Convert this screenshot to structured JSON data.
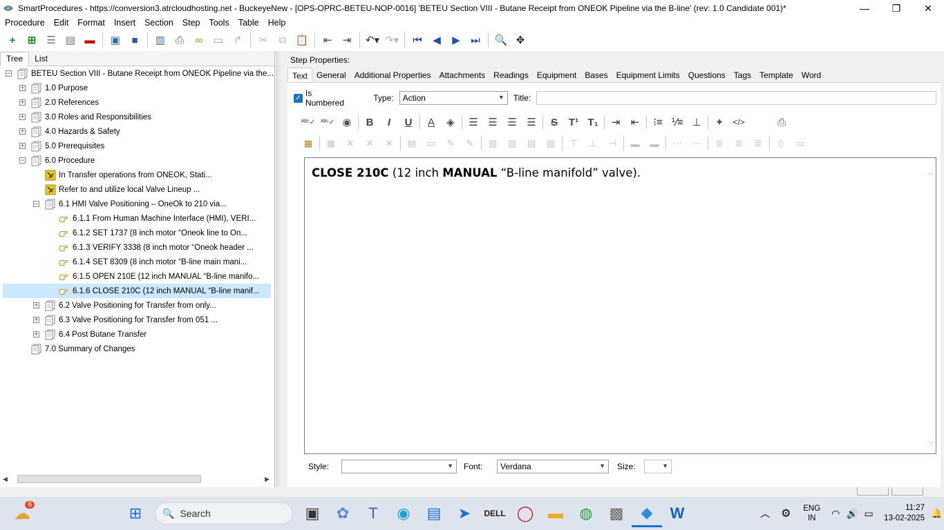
{
  "window": {
    "title": "SmartProcedures - https://conversion3.atrcloudhosting.net - BuckeyeNew - [OPS-OPRC-BETEU-NOP-0016] 'BETEU Section VIII - Butane Receipt from ONEOK Pipeline via the B-line' (rev: 1.0 Candidate 001)*",
    "minimize_glyph": "—",
    "restore_glyph": "❐",
    "close_glyph": "✕"
  },
  "menu": [
    "Procedure",
    "Edit",
    "Format",
    "Insert",
    "Section",
    "Step",
    "Tools",
    "Table",
    "Help"
  ],
  "left_tabs": [
    "Tree",
    "List"
  ],
  "tree": [
    {
      "label": "BETEU Section VIII - Butane Receipt from ONEOK Pipeline via the...",
      "indent": 0,
      "exp": "−",
      "icon": "section"
    },
    {
      "label": "1.0 Purpose",
      "indent": 1,
      "exp": "+",
      "icon": "section"
    },
    {
      "label": "2.0 References",
      "indent": 1,
      "exp": "+",
      "icon": "section"
    },
    {
      "label": "3.0 Roles and Responsibilities",
      "indent": 1,
      "exp": "+",
      "icon": "section"
    },
    {
      "label": "4.0 Hazards & Safety",
      "indent": 1,
      "exp": "+",
      "icon": "section"
    },
    {
      "label": "5.0 Prerequisites",
      "indent": 1,
      "exp": "+",
      "icon": "section"
    },
    {
      "label": "6.0 Procedure",
      "indent": 1,
      "exp": "−",
      "icon": "section"
    },
    {
      "label": "In Transfer operations from ONEOK, Stati...",
      "indent": 2,
      "exp": "",
      "icon": "note"
    },
    {
      "label": "Refer to and utilize local Valve Lineup ...",
      "indent": 2,
      "exp": "",
      "icon": "note"
    },
    {
      "label": "6.1 HMI Valve Positioning – OneOk to 210 via...",
      "indent": 2,
      "exp": "−",
      "icon": "section"
    },
    {
      "label": "6.1.1 From Human Machine Interface (HMI), VERI...",
      "indent": 3,
      "exp": "",
      "icon": "step"
    },
    {
      "label": "6.1.2 SET 1737 (8 inch motor “Oneok line to On...",
      "indent": 3,
      "exp": "",
      "icon": "step"
    },
    {
      "label": "6.1.3 VERIFY 3338 (8 inch motor “Oneok header ...",
      "indent": 3,
      "exp": "",
      "icon": "step"
    },
    {
      "label": "6.1.4 SET 8309 (8 inch motor “B-line main mani...",
      "indent": 3,
      "exp": "",
      "icon": "step"
    },
    {
      "label": "6.1.5 OPEN 210E (12 inch MANUAL “B-line manifo...",
      "indent": 3,
      "exp": "",
      "icon": "step"
    },
    {
      "label": "6.1.6 CLOSE 210C (12 inch MANUAL “B-line manif...",
      "indent": 3,
      "exp": "",
      "icon": "step",
      "selected": true
    },
    {
      "label": "6.2 Valve Positioning for Transfer from only...",
      "indent": 2,
      "exp": "+",
      "icon": "section"
    },
    {
      "label": "6.3 Valve Positioning for Transfer from 051 ...",
      "indent": 2,
      "exp": "+",
      "icon": "section"
    },
    {
      "label": "6.4 Post Butane Transfer",
      "indent": 2,
      "exp": "+",
      "icon": "section"
    },
    {
      "label": "7.0 Summary of Changes",
      "indent": 1,
      "exp": "",
      "icon": "section"
    }
  ],
  "step_properties": {
    "header": "Step Properties:",
    "tabs": [
      "Text",
      "General",
      "Additional Properties",
      "Attachments",
      "Readings",
      "Equipment",
      "Bases",
      "Equipment Limits",
      "Questions",
      "Tags",
      "Template",
      "Word"
    ],
    "is_numbered_label": "Is Numbered",
    "is_numbered": true,
    "type_label": "Type:",
    "type_value": "Action",
    "title_label": "Title:",
    "title_value": "",
    "editor": {
      "part1": "CLOSE 210C",
      "part2": " (12 inch ",
      "part3": "MANUAL",
      "part4": " “B-line manifold” valve)."
    },
    "style_label": "Style:",
    "style_value": "",
    "font_label": "Font:",
    "font_value": "Verdana",
    "size_label": "Size:",
    "size_value": ""
  },
  "taskbar": {
    "weather_badge": "6",
    "search_placeholder": "Search",
    "lang_line1": "ENG",
    "lang_line2": "IN",
    "time": "11:27",
    "date": "13-02-2025"
  }
}
